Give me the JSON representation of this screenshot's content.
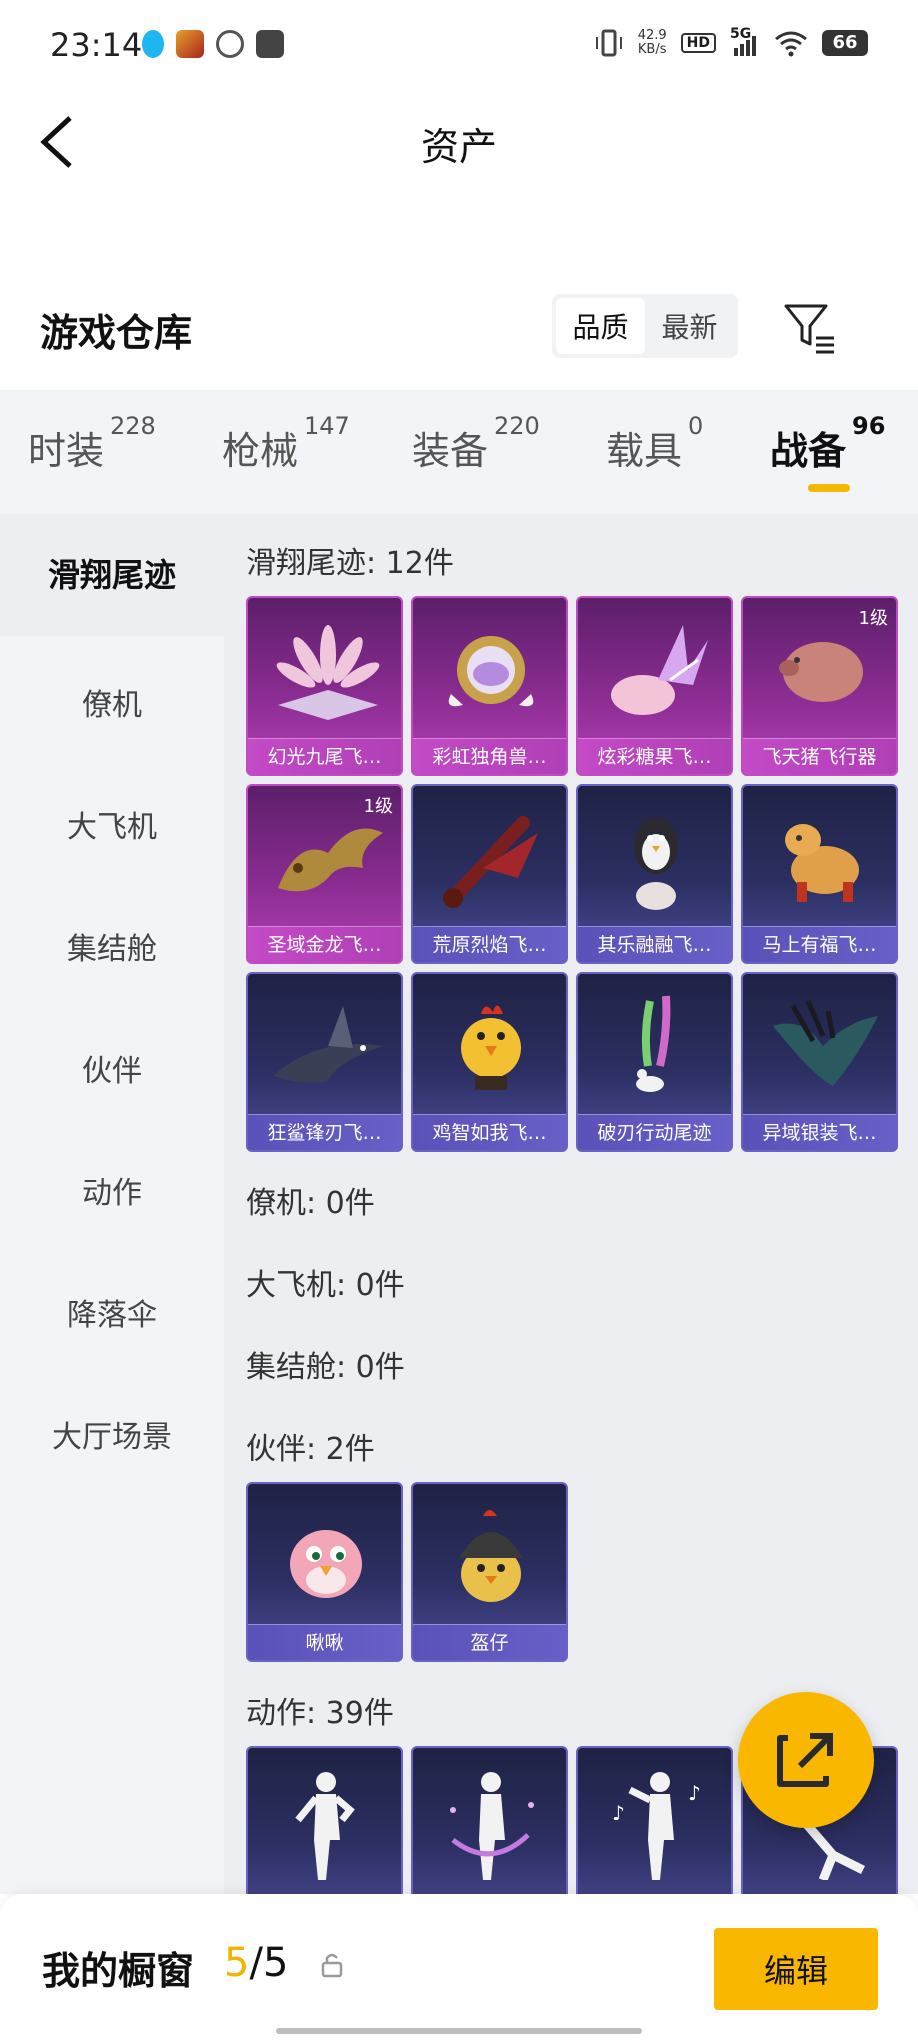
{
  "status_bar": {
    "time": "23:14",
    "network_speed": "42.9",
    "speed_unit": "KB/s",
    "hd_badge": "HD",
    "network": "5G",
    "battery": "66"
  },
  "header": {
    "title": "资产",
    "back_icon": "chevron-left-icon"
  },
  "warehouse": {
    "title": "游戏仓库",
    "sort_options": [
      "品质",
      "最新"
    ],
    "active_sort": "品质",
    "filter_icon": "filter-funnel-icon"
  },
  "category_tabs": [
    {
      "label": "时装",
      "count": "228"
    },
    {
      "label": "枪械",
      "count": "147"
    },
    {
      "label": "装备",
      "count": "220"
    },
    {
      "label": "载具",
      "count": "0"
    },
    {
      "label": "战备",
      "count": "96",
      "active": true
    }
  ],
  "sidebar": {
    "items": [
      "滑翔尾迹",
      "僚机",
      "大飞机",
      "集结舱",
      "伙伴",
      "动作",
      "降落伞",
      "大厅场景"
    ],
    "active": "滑翔尾迹"
  },
  "sections": {
    "glide_trail": {
      "title": "滑翔尾迹: 12件",
      "items": [
        {
          "name": "幻光九尾飞…",
          "rarity": "purple"
        },
        {
          "name": "彩虹独角兽…",
          "rarity": "purple"
        },
        {
          "name": "炫彩糖果飞…",
          "rarity": "purple"
        },
        {
          "name": "飞天猪飞行器",
          "rarity": "purple",
          "badge": "1级"
        },
        {
          "name": "圣域金龙飞…",
          "rarity": "purple",
          "badge": "1级"
        },
        {
          "name": "荒原烈焰飞…",
          "rarity": "blue"
        },
        {
          "name": "其乐融融飞…",
          "rarity": "blue"
        },
        {
          "name": "马上有福飞…",
          "rarity": "blue"
        },
        {
          "name": "狂鲨锋刃飞…",
          "rarity": "blue"
        },
        {
          "name": "鸡智如我飞…",
          "rarity": "blue"
        },
        {
          "name": "破刃行动尾迹",
          "rarity": "blue"
        },
        {
          "name": "异域银装飞…",
          "rarity": "blue"
        }
      ]
    },
    "wingman": {
      "title": "僚机: 0件"
    },
    "big_plane": {
      "title": "大飞机: 0件"
    },
    "rally_pod": {
      "title": "集结舱: 0件"
    },
    "partner": {
      "title": "伙伴: 2件",
      "items": [
        {
          "name": "啾啾",
          "rarity": "blue"
        },
        {
          "name": "盔仔",
          "rarity": "blue"
        }
      ]
    },
    "emote": {
      "title": "动作: 39件"
    }
  },
  "fab": {
    "icon": "share-external-icon"
  },
  "showcase": {
    "title": "我的橱窗",
    "current": "5",
    "separator": "/",
    "total": "5",
    "lock_icon": "lock-icon",
    "edit_label": "编辑"
  }
}
